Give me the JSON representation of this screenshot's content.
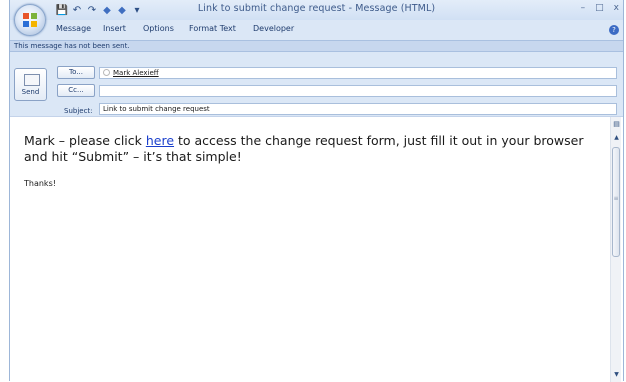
{
  "window": {
    "title": "Link to submit change request - Message (HTML)",
    "controls": {
      "minimize": "–",
      "maximize": "□",
      "close": "x"
    }
  },
  "quick_access": {
    "save": "💾",
    "undo": "↶",
    "redo": "↷",
    "prev": "◆",
    "next": "◆",
    "customize": "▾"
  },
  "ribbon": {
    "tabs": [
      "Message",
      "Insert",
      "Options",
      "Format Text",
      "Developer"
    ],
    "help": "?"
  },
  "info_bar": {
    "text": "This message has not been sent."
  },
  "header": {
    "send_label": "Send",
    "to_button": "To...",
    "cc_button": "Cc...",
    "subject_label": "Subject:",
    "to_value": "Mark Alexieff",
    "cc_value": "",
    "subject_value": "Link to submit change request"
  },
  "body": {
    "line_before_link": "Mark – please click ",
    "link_text": "here",
    "line_after_link": " to access the change request form, just fill it out in your browser and hit “Submit” – it’s that simple!",
    "thanks": "Thanks!"
  },
  "colors": {
    "accent": "#1a3fcc",
    "chrome": "#dbe7f6",
    "text": "#1f3c6e"
  }
}
